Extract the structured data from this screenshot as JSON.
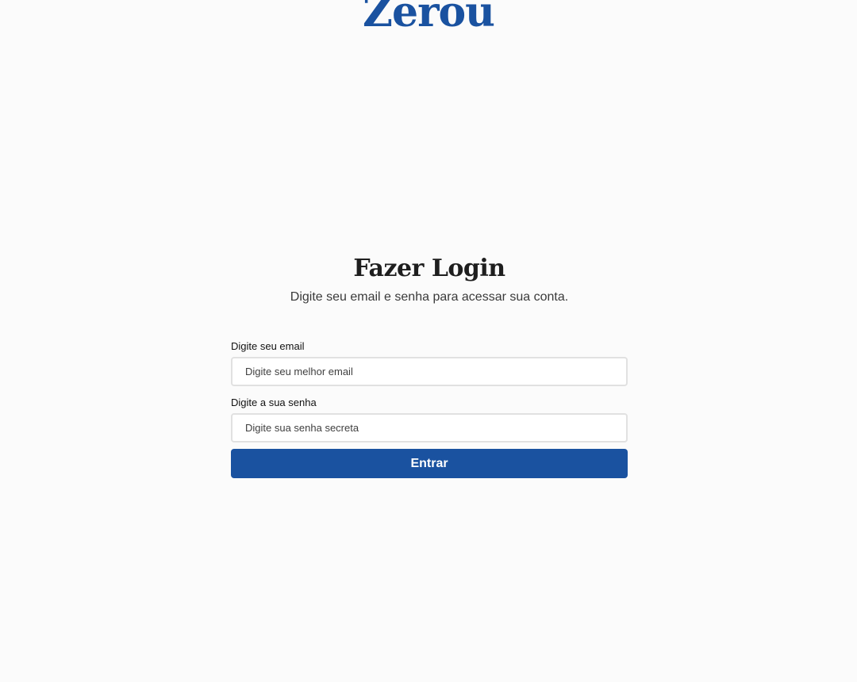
{
  "brand": {
    "logo_text": "Zerou",
    "color": "#1a52a0"
  },
  "login": {
    "title": "Fazer Login",
    "subtitle": "Digite seu email e senha para acessar sua conta.",
    "email": {
      "label": "Digite seu email",
      "placeholder": "Digite seu melhor email",
      "value": ""
    },
    "password": {
      "label": "Digite a sua senha",
      "placeholder": "Digite sua senha secreta",
      "value": ""
    },
    "submit_label": "Entrar"
  }
}
